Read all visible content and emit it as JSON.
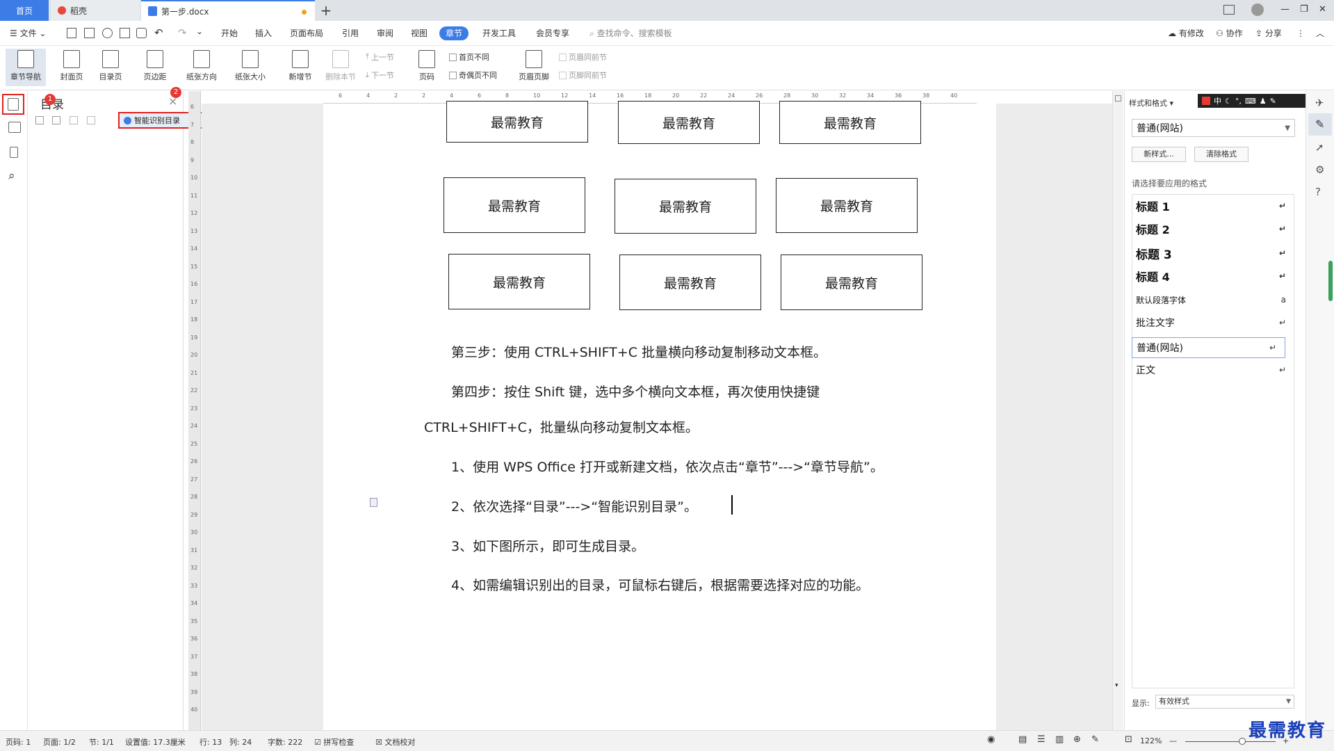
{
  "tabs": {
    "home": "首页",
    "daoke": "稻壳",
    "doc": "第一步.docx",
    "add": "+"
  },
  "window": {
    "avatar_icon": "user-avatar-icon",
    "minimize": "—",
    "restore": "❐",
    "close": "✕"
  },
  "menubar": {
    "file": "文件",
    "items": [
      "开始",
      "插入",
      "页面布局",
      "引用",
      "审阅",
      "视图",
      "章节",
      "开发工具",
      "会员专享"
    ],
    "active": "章节",
    "search": "查找命令、搜索模板",
    "right": [
      "有修改",
      "协作",
      "分享"
    ]
  },
  "ribbon": {
    "buttons": [
      "章节导航",
      "封面页",
      "目录页",
      "页边距",
      "纸张方向",
      "纸张大小",
      "新增节",
      "删除本节",
      "页码",
      "页眉页脚"
    ],
    "prev_section": "上一节",
    "next_section": "下一节",
    "checks": [
      "首页不同",
      "奇偶页不同",
      "页眉同前节",
      "页脚同前节"
    ]
  },
  "nav": {
    "title": "目录",
    "smart_button": "智能识别目录",
    "badge1": "1",
    "badge2": "2",
    "close": "×"
  },
  "ruler": {
    "h_ticks": [
      "6",
      "4",
      "2",
      "2",
      "4",
      "6",
      "8",
      "10",
      "12",
      "14",
      "16",
      "18",
      "20",
      "22",
      "24",
      "26",
      "28",
      "30",
      "32",
      "34",
      "36",
      "38",
      "40"
    ],
    "v_ticks": [
      "6",
      "7",
      "8",
      "9",
      "10",
      "11",
      "12",
      "13",
      "14",
      "15",
      "16",
      "17",
      "18",
      "19",
      "20",
      "21",
      "22",
      "23",
      "24",
      "25",
      "26",
      "27",
      "28",
      "29",
      "30",
      "31",
      "32",
      "33",
      "34",
      "35",
      "36",
      "37",
      "38",
      "39",
      "40"
    ]
  },
  "doc": {
    "box_text": "最需教育",
    "p1": "第三步：使用 CTRL+SHIFT+C 批量横向移动复制移动文本框。",
    "p2": "第四步：按住 Shift 键，选中多个横向文本框，再次使用快捷键",
    "p3": "CTRL+SHIFT+C，批量纵向移动复制文本框。",
    "p4": "1、使用 WPS Office 打开或新建文档，依次点击“章节”--->“章节导航”。",
    "p5": "2、依次选择“目录”--->“智能识别目录”。",
    "p6": "3、如下图所示，即可生成目录。",
    "p7": "4、如需编辑识别出的目录，可鼠标右键后，根据需要选择对应的功能。"
  },
  "styles": {
    "header": "样式和格式",
    "current": "普通(网站)",
    "new_style": "新样式...",
    "clear": "清除格式",
    "prompt": "请选择要应用的格式",
    "items": [
      {
        "name": "标题  1"
      },
      {
        "name": "标题  2"
      },
      {
        "name": "标题  3"
      },
      {
        "name": "标题  4"
      },
      {
        "name": "默认段落字体"
      },
      {
        "name": "批注文字"
      },
      {
        "name": "普通(网站)"
      },
      {
        "name": "正文"
      }
    ],
    "show_label": "显示:",
    "show_value": "有效样式",
    "ime": "中"
  },
  "status": {
    "page": "页码: 1",
    "pages": "页面: 1/2",
    "section": "节: 1/1",
    "setting": "设置值: 17.3厘米",
    "row": "行: 13",
    "col": "列: 24",
    "words": "字数: 222",
    "spell": "拼写检查",
    "proof": "文档校对",
    "zoom": "122%"
  },
  "watermark": "最需教育"
}
